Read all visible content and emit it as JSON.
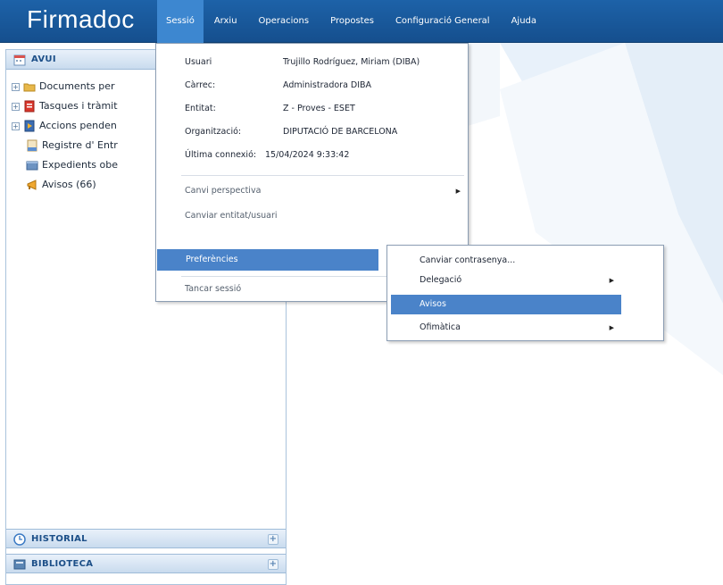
{
  "app": {
    "logo": "Firmadoc"
  },
  "menubar": {
    "items": [
      "Sessió",
      "Arxiu",
      "Operacions",
      "Propostes",
      "Configuració General",
      "Ajuda"
    ],
    "active": "Sessió"
  },
  "sidebar": {
    "top_panel": {
      "title": "AVUI",
      "icon": "calendar-icon"
    },
    "tree": [
      {
        "label": "Documents per",
        "icon": "folder-icon",
        "expandable": true
      },
      {
        "label": "Tasques i tràmit",
        "icon": "tasks-icon",
        "expandable": true
      },
      {
        "label": "Accions penden",
        "icon": "actions-icon",
        "expandable": true
      },
      {
        "label": "Registre d' Entr",
        "icon": "register-icon",
        "expandable": false
      },
      {
        "label": "Expedients obe",
        "icon": "files-icon",
        "expandable": false
      },
      {
        "label": "Avisos (66)",
        "icon": "megaphone-icon",
        "expandable": false
      }
    ],
    "bottom_panels": [
      {
        "title": "HISTORIAL",
        "icon": "history-icon"
      },
      {
        "title": "BIBLIOTECA",
        "icon": "library-icon"
      }
    ]
  },
  "session_menu": {
    "info": [
      {
        "key": "Usuari",
        "value": "Trujillo Rodríguez, Miriam (DIBA)"
      },
      {
        "key": "Càrrec:",
        "value": "Administradora DIBA"
      },
      {
        "key": "Entitat:",
        "value": "Z - Proves - ESET"
      },
      {
        "key": "Organització:",
        "value": "DIPUTACIÓ DE BARCELONA"
      },
      {
        "key": "Última connexió:",
        "value": "15/04/2024 9:33:42"
      }
    ],
    "items": [
      {
        "label": "Canvi perspectiva",
        "submenu": true
      },
      {
        "label": "Canviar entitat/usuari",
        "submenu": false
      },
      {
        "label": "Preferències",
        "submenu": true,
        "active": true
      },
      {
        "label": "Tancar sessió",
        "submenu": false
      }
    ]
  },
  "preferences_submenu": {
    "items": [
      {
        "label": "Canviar contrasenya...",
        "submenu": false
      },
      {
        "label": "Delegació",
        "submenu": true
      },
      {
        "label": "Avisos",
        "submenu": false,
        "active": true
      },
      {
        "label": "Ofimàtica",
        "submenu": true
      }
    ]
  },
  "colors": {
    "topbar": "#1d62a8",
    "menu_active": "#3d87d0",
    "highlight": "#4a83c9",
    "background_shape": "#e4eef8"
  }
}
